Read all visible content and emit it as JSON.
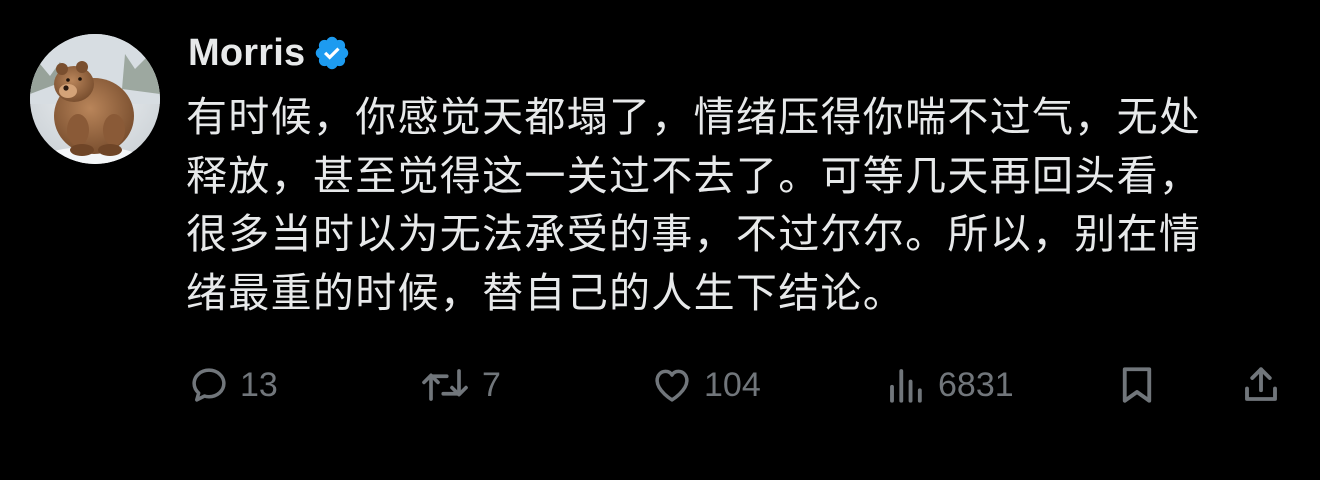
{
  "author": {
    "name": "Morris",
    "verified_color": "#1d9bf0",
    "avatar_icon": "bear-avatar"
  },
  "tweet": {
    "lines": [
      "有时候，你感觉天都塌了，情绪压得你喘不过气，无处",
      "释放，甚至觉得这一关过不去了。可等几天再回头看，",
      "很多当时以为无法承受的事，不过尔尔。所以，别在情",
      "绪最重的时候，替自己的人生下结论。"
    ]
  },
  "actions": {
    "reply": {
      "icon": "reply-icon",
      "count": "13"
    },
    "retweet": {
      "icon": "retweet-icon",
      "count": "7"
    },
    "like": {
      "icon": "heart-icon",
      "count": "104"
    },
    "views": {
      "icon": "views-icon",
      "count": "6831"
    },
    "bookmark": {
      "icon": "bookmark-icon"
    },
    "share": {
      "icon": "share-icon"
    }
  },
  "colors": {
    "background": "#000000",
    "text": "#e7e9ea",
    "muted": "#71767b",
    "accent": "#1d9bf0"
  }
}
